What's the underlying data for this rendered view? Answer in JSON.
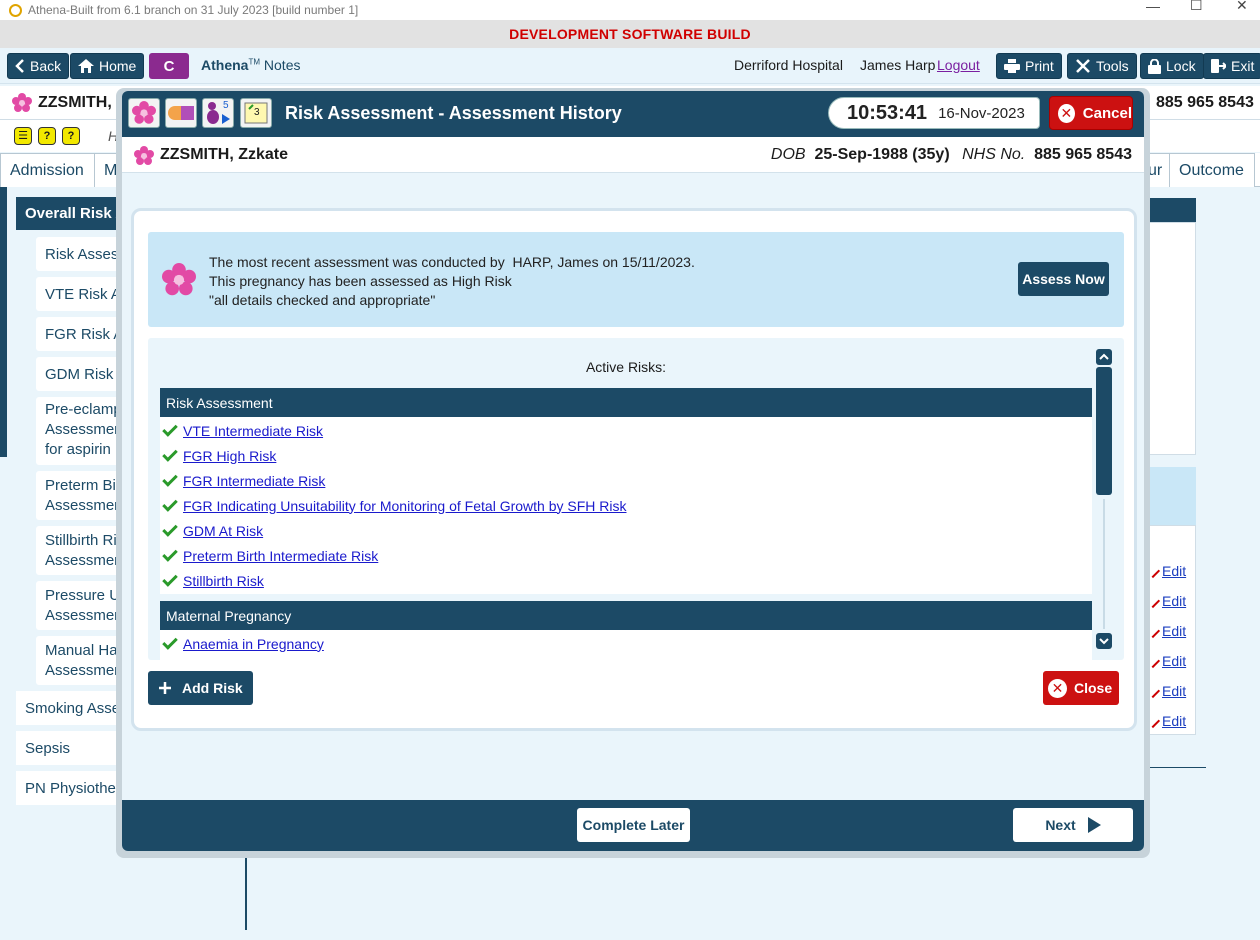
{
  "window": {
    "title": "Athena-Built from 6.1 branch on 31 July 2023 [build number 1]",
    "dev_banner": "DEVELOPMENT SOFTWARE BUILD"
  },
  "toolbar": {
    "back": "Back",
    "home": "Home",
    "c_button": "C",
    "app_name": "Athena",
    "app_tm": "TM",
    "app_module": "Notes",
    "hospital": "Derriford Hospital",
    "user": "James Harp",
    "logout": "Logout",
    "print": "Print",
    "tools": "Tools",
    "lock": "Lock",
    "exit": "Exit"
  },
  "background": {
    "patient_short": "ZZSMITH, Z",
    "nhs_right": "885 965 8543",
    "h_label": "H",
    "tabs": [
      "Admission",
      "M",
      "ur",
      "Outcome"
    ],
    "left_nav": {
      "header": "Overall Risk A",
      "items": [
        "Risk Assess",
        "VTE Risk As",
        "FGR Risk A",
        "GDM Risk A",
        "Pre-eclamp\nAssessmen\nfor aspirin",
        "Preterm Bir\nAssessmen",
        "Stillbirth Ri\nAssessmen",
        "Pressure Ul\nAssessmen",
        "Manual Ha\nAssessmen"
      ],
      "groups": [
        "Smoking Asse",
        "Sepsis",
        "PN Physiother"
      ]
    },
    "edit_label": "Edit"
  },
  "modal": {
    "title": "Risk Assessment - Assessment History",
    "badge_5": "5",
    "badge_3": "3",
    "time": "10:53:41",
    "date": "16-Nov-2023",
    "cancel": "Cancel",
    "patient_name": "ZZSMITH, Zzkate",
    "dob_label": "DOB",
    "dob_value": "25-Sep-1988 (35y)",
    "nhs_label": "NHS No.",
    "nhs_value": "885 965 8543",
    "info_line1": "The most recent assessment was conducted by  HARP, James on 15/11/2023.",
    "info_line2": "This pregnancy has been assessed as High Risk",
    "info_line3": "\"all details checked and appropriate\"",
    "assess_now": "Assess Now",
    "active_risks_label": "Active Risks:",
    "sections": [
      {
        "title": "Risk Assessment",
        "risks": [
          "VTE Intermediate Risk",
          "FGR High Risk",
          "FGR Intermediate Risk",
          "FGR Indicating Unsuitability for Monitoring of Fetal Growth by SFH Risk",
          "GDM At Risk",
          "Preterm Birth Intermediate Risk",
          "Stillbirth Risk"
        ]
      },
      {
        "title": "Maternal Pregnancy",
        "risks": [
          "Anaemia in Pregnancy"
        ]
      }
    ],
    "add_risk": "Add Risk",
    "close": "Close",
    "complete_later": "Complete Later",
    "next": "Next"
  },
  "colors": {
    "navy": "#1c4a66",
    "red": "#cc1111",
    "dev_red": "#d00000",
    "info_blue": "#c9e7f7",
    "tick_green": "#2a9a2a"
  }
}
